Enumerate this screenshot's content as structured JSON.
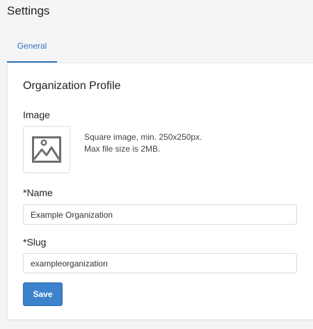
{
  "header": {
    "title": "Settings"
  },
  "tabs": [
    {
      "label": "General",
      "active": true
    }
  ],
  "profile": {
    "section_title": "Organization Profile",
    "image": {
      "label": "Image",
      "icon": "image-placeholder-icon",
      "hint_line1": "Square image, min. 250x250px.",
      "hint_line2": "Max file size is 2MB."
    },
    "name": {
      "label": "*Name",
      "value": "Example Organization"
    },
    "slug": {
      "label": "*Slug",
      "value": "exampleorganization"
    },
    "save_label": "Save"
  },
  "colors": {
    "accent": "#2f74c0",
    "button": "#3d82cc",
    "background": "#f4f5f7"
  }
}
